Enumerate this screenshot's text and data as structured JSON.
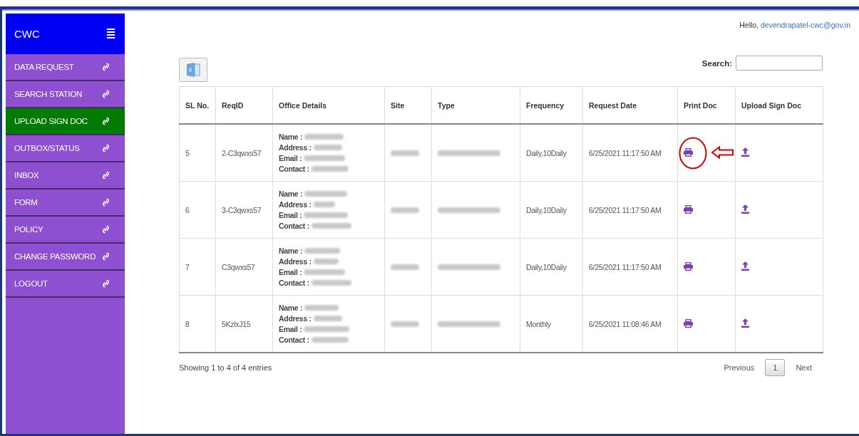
{
  "sidebar": {
    "brand": "CWC",
    "menu_icon": "≣",
    "items": [
      {
        "label": "DATA REQUEST",
        "selected": false
      },
      {
        "label": "SEARCH STATION",
        "selected": false
      },
      {
        "label": "UPLOAD SIGN DOC",
        "selected": true
      },
      {
        "label": "OUTBOX/STATUS",
        "selected": false
      },
      {
        "label": "INBOX",
        "selected": false
      },
      {
        "label": "FORM",
        "selected": false
      },
      {
        "label": "POLICY",
        "selected": false
      },
      {
        "label": "CHANGE PASSWORD",
        "selected": false
      },
      {
        "label": "LOGOUT",
        "selected": false
      }
    ]
  },
  "greeting": {
    "text": "Hello, ",
    "user": "devendrapatel-cwc@gov.in"
  },
  "search": {
    "label": "Search:"
  },
  "table": {
    "columns": [
      "SL No.",
      "ReqID",
      "Office Details",
      "Site",
      "Type",
      "Frequency",
      "Request Date",
      "Print Doc",
      "Upload Sign Doc"
    ],
    "rows": [
      {
        "sl": "5",
        "req_id": "2-C3qwxs57",
        "office_labels": [
          "Name :",
          "Address :",
          "Email :",
          "Contact :"
        ],
        "frequency": "Daily,10Daily",
        "request_date": "6/25/2021 11:17:50 AM",
        "annotated": true
      },
      {
        "sl": "6",
        "req_id": "3-C3qwxs57",
        "office_labels": [
          "Name :",
          "Address :",
          "Email :",
          "Contact :"
        ],
        "frequency": "Daily,10Daily",
        "request_date": "6/25/2021 11:17:50 AM",
        "annotated": false
      },
      {
        "sl": "7",
        "req_id": "C3qwxs57",
        "office_labels": [
          "Name :",
          "Address :",
          "Email :",
          "Contact :"
        ],
        "frequency": "Daily,10Daily",
        "request_date": "6/25/2021 11:17:50 AM",
        "annotated": false
      },
      {
        "sl": "8",
        "req_id": "5KzlxJ15",
        "office_labels": [
          "Name :",
          "Address :",
          "Email :",
          "Contact :"
        ],
        "frequency": "Monthly",
        "request_date": "6/25/2021 11:08:46 AM",
        "annotated": false
      }
    ]
  },
  "footer": {
    "info": "Showing 1 to 4 of 4 entries",
    "pagination": [
      {
        "label": "Previous",
        "selected": false
      },
      {
        "label": "1",
        "selected": true
      },
      {
        "label": "Next",
        "selected": false
      }
    ]
  }
}
